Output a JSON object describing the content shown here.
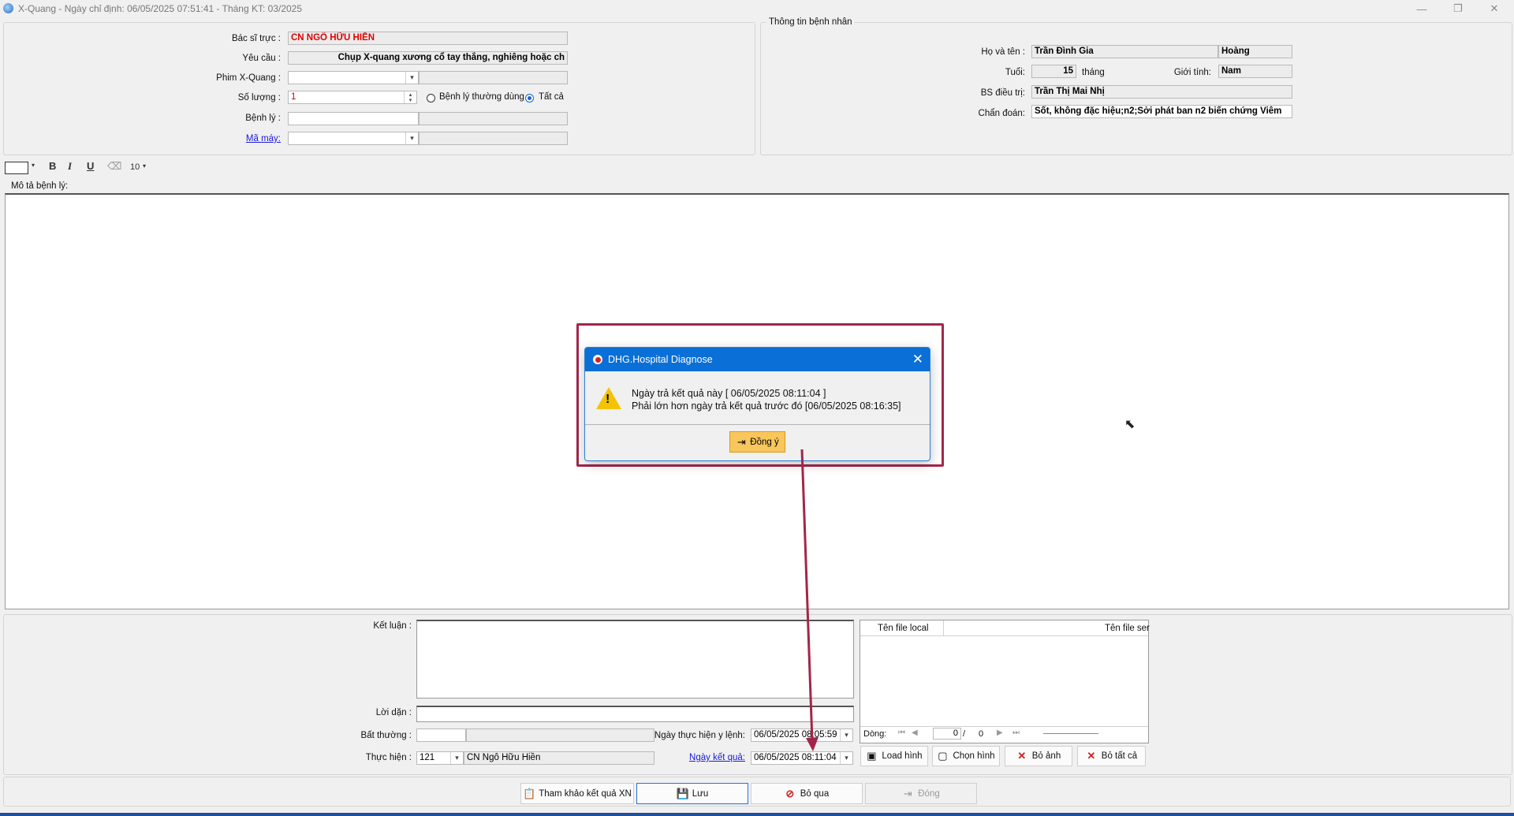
{
  "window": {
    "title": "X-Quang - Ngày chỉ định: 06/05/2025 07:51:41 - Tháng KT: 03/2025",
    "minimize": "—",
    "restore": "❐",
    "close": "✕"
  },
  "order": {
    "doctor_label": "Bác sĩ trực :",
    "doctor_value": "CN NGÔ HỮU HIỀN",
    "request_label": "Yêu cầu :",
    "request_value": "Chụp X-quang xương cổ tay thẳng, nghiêng hoặc ch",
    "film_label": "Phim X-Quang :",
    "film_value": "",
    "quantity_label": "Số lượng :",
    "quantity_value": "1",
    "radio_common": "Bệnh lý thường dùng",
    "radio_all": "Tất cả",
    "disease_label": "Bệnh lý :",
    "machine_label": "Mã máy:"
  },
  "patient": {
    "group_title": "Thông tin bệnh nhân",
    "name_label": "Họ và tên :",
    "name_value": "Trần Đình Gia",
    "name_value2": "Hoàng",
    "age_label": "Tuổi:",
    "age_value": "15",
    "age_unit": "tháng",
    "gender_label": "Giới tính:",
    "gender_value": "Nam",
    "doctor_label": "BS điều trị:",
    "doctor_value": "Trần Thị Mai Nhị",
    "diagnosis_label": "Chẩn đoán:",
    "diagnosis_value": "Sốt, không đặc hiệu;n2;Sởi phát ban n2 biến chứng Viêm"
  },
  "toolbar": {
    "bold": "B",
    "italic": "I",
    "underline": "U",
    "font_size": "10"
  },
  "description_label": "Mô tả bệnh lý:",
  "result": {
    "conclusion_label": "Kết luận :",
    "advice_label": "Lời dặn :",
    "abnormal_label": "Bất thường :",
    "performer_label": "Thực hiện :",
    "performer_code": "121",
    "performer_name": "CN Ngô Hữu Hiền",
    "exec_date_label": "Ngày thực hiện y lệnh:",
    "exec_date_value": "06/05/2025 08:05:59",
    "result_date_label": "Ngày kết quả:",
    "result_date_value": "06/05/2025 08:11:04"
  },
  "files": {
    "col_local": "Tên file local",
    "col_server": "Tên file ser",
    "row_label": "Dòng:",
    "row_current": "0",
    "row_sep": "/",
    "row_total": "0",
    "load_image": "Load hình",
    "choose_image": "Chọn hình",
    "remove_image": "Bỏ ảnh",
    "remove_all": "Bỏ tất cả"
  },
  "footer": {
    "reference": "Tham khảo kết quả XN",
    "save": "Lưu",
    "skip": "Bỏ qua",
    "close": "Đóng"
  },
  "dialog": {
    "title": "DHG.Hospital Diagnose",
    "line1": "Ngày trả kết quả này [ 06/05/2025 08:11:04 ]",
    "line2": "Phải lớn hơn ngày trả kết quả trước đó [06/05/2025 08:16:35]",
    "ok": "Đồng ý",
    "close_glyph": "✕"
  },
  "colors": {
    "dialog_title_bg": "#0a6fd6",
    "highlight": "#a3264a",
    "ok_button": "#f9c65c",
    "doctor_text": "#e00000",
    "link": "#1a1adc"
  },
  "icons": [
    "app-icon",
    "warning-icon",
    "shield-icon",
    "door-exit-icon",
    "save-disk-icon",
    "cancel-icon",
    "image-icon",
    "delete-x-icon",
    "clipboard-icon",
    "cursor-arrow-icon"
  ]
}
